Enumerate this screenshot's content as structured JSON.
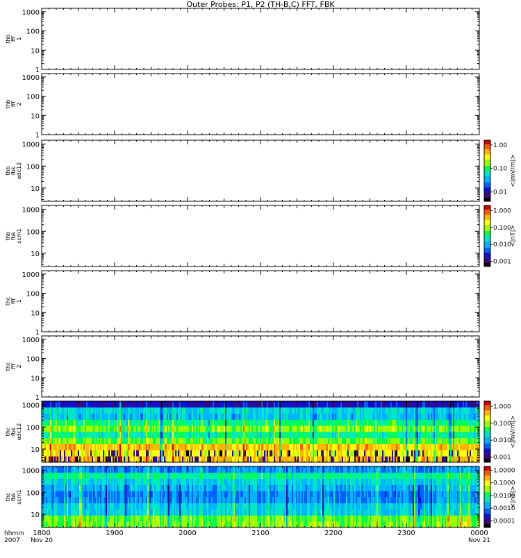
{
  "title": "Outer Probes: P1, P2 (TH-B,C) FFT, FBK",
  "x_axis": {
    "row_label_1": "hhmm",
    "row_label_2": "2007",
    "ticks": [
      {
        "label": "1800",
        "date": "Nov 20"
      },
      {
        "label": "1900",
        "date": ""
      },
      {
        "label": "2000",
        "date": ""
      },
      {
        "label": "2100",
        "date": ""
      },
      {
        "label": "2200",
        "date": ""
      },
      {
        "label": "2300",
        "date": ""
      },
      {
        "label": "0000",
        "date": "Nov 21"
      }
    ]
  },
  "colors": {
    "spectrum": [
      "#000000",
      "#3c0a80",
      "#1010d0",
      "#0060ff",
      "#00b4ff",
      "#00e6c8",
      "#00ff50",
      "#9cff00",
      "#ffff00",
      "#ffb400",
      "#ff5a00",
      "#d20000"
    ]
  },
  "chart_data": [
    {
      "type": "heatmap",
      "label_lines": [
        "thb",
        "fff",
        "1"
      ],
      "y_ticks": [
        "1",
        "10",
        "100",
        "1000"
      ],
      "y_scale": "log",
      "ylim": [
        1,
        1500
      ],
      "has_data": false,
      "colorbar": null
    },
    {
      "type": "heatmap",
      "label_lines": [
        "thb",
        "fff",
        "2"
      ],
      "y_ticks": [
        "1",
        "10",
        "100",
        "1000"
      ],
      "y_scale": "log",
      "ylim": [
        1,
        1500
      ],
      "has_data": false,
      "colorbar": null
    },
    {
      "type": "heatmap",
      "label_lines": [
        "thb",
        "fbk",
        "edc12"
      ],
      "y_ticks": [
        "10",
        "100",
        "1000"
      ],
      "y_scale": "log",
      "ylim": [
        2.5,
        1500
      ],
      "has_data": false,
      "colorbar": {
        "label": "<|mV/m|>",
        "ticks": [
          "1.00",
          "0.10",
          "0.01"
        ],
        "range": [
          0.004,
          1.6
        ]
      }
    },
    {
      "type": "heatmap",
      "label_lines": [
        "thb",
        "fbk",
        "scm1"
      ],
      "y_ticks": [
        "10",
        "100",
        "1000"
      ],
      "y_scale": "log",
      "ylim": [
        2.5,
        1500
      ],
      "has_data": false,
      "colorbar": {
        "label": "<|nT|>",
        "ticks": [
          "1.000",
          "0.100",
          "0.010",
          "0.001"
        ],
        "range": [
          0.0005,
          2
        ]
      }
    },
    {
      "type": "heatmap",
      "label_lines": [
        "thc",
        "fff",
        "1"
      ],
      "y_ticks": [
        "1",
        "10",
        "100",
        "1000"
      ],
      "y_scale": "log",
      "ylim": [
        1,
        1500
      ],
      "has_data": false,
      "colorbar": null
    },
    {
      "type": "heatmap",
      "label_lines": [
        "thc",
        "fff",
        "2"
      ],
      "y_ticks": [
        "1",
        "10",
        "100",
        "1000"
      ],
      "y_scale": "log",
      "ylim": [
        1,
        1500
      ],
      "has_data": false,
      "colorbar": null
    },
    {
      "type": "heatmap",
      "label_lines": [
        "thc",
        "fbk",
        "edc12"
      ],
      "y_ticks": [
        "10",
        "100",
        "1000"
      ],
      "y_scale": "log",
      "ylim": [
        2.5,
        1500
      ],
      "has_data": true,
      "band_levels": [
        8.8,
        7.9,
        8.7,
        6.6,
        5.4,
        6.8,
        5.7,
        4.3,
        4.6,
        1.8
      ],
      "colorbar": {
        "label": "<|mV/m|>",
        "ticks": [
          "1.000",
          "0.100",
          "0.010",
          "0.001"
        ],
        "range": [
          0.0005,
          2
        ]
      }
    },
    {
      "type": "heatmap",
      "label_lines": [
        "thc",
        "fbk",
        "scm1"
      ],
      "y_ticks": [
        "10",
        "100",
        "1000"
      ],
      "y_scale": "log",
      "ylim": [
        2.5,
        1500
      ],
      "has_data": true,
      "band_levels": [
        6.7,
        6.6,
        4.6,
        4.5,
        3.6,
        3.5,
        4.1,
        4.6,
        5.5,
        3.6
      ],
      "colorbar": {
        "label": "<|nT|>",
        "ticks": [
          "1.0000",
          "0.1000",
          "0.0100",
          "0.0010",
          "0.0001"
        ],
        "range": [
          3e-05,
          2
        ]
      }
    }
  ]
}
